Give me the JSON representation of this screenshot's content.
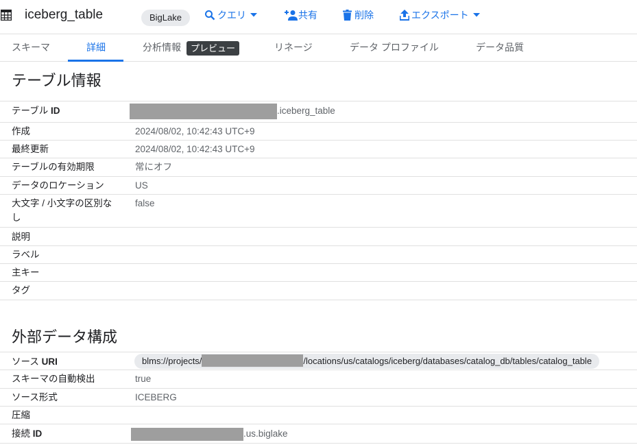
{
  "header": {
    "table_name": "iceberg_table",
    "table_type_chip": "BigLake",
    "actions": {
      "query": "クエリ",
      "share": "共有",
      "delete": "削除",
      "export": "エクスポート"
    }
  },
  "tabs": [
    {
      "label": "スキーマ"
    },
    {
      "label": "詳細",
      "active": true
    },
    {
      "label": "分析情報",
      "badge": "プレビュー"
    },
    {
      "label": "リネージ"
    },
    {
      "label": "データ プロファイル"
    },
    {
      "label": "データ品質"
    }
  ],
  "table_info": {
    "title": "テーブル情報",
    "rows": {
      "table_id": {
        "label_prefix": "テーブル ",
        "label_bold": "ID",
        "value_suffix": ".iceberg_table"
      },
      "created": {
        "label": "作成",
        "value": "2024/08/02, 10:42:43 UTC+9"
      },
      "last_modified": {
        "label": "最終更新",
        "value": "2024/08/02, 10:42:43 UTC+9"
      },
      "expiration": {
        "label": "テーブルの有効期限",
        "value": "常にオフ"
      },
      "location": {
        "label": "データのロケーション",
        "value": "US"
      },
      "case_insensitive": {
        "label": "大文字 / 小文字の区別なし",
        "value": "false"
      },
      "description": {
        "label": "説明",
        "value": ""
      },
      "labels": {
        "label": "ラベル",
        "value": ""
      },
      "primary_key": {
        "label": "主キー",
        "value": ""
      },
      "tags": {
        "label": "タグ",
        "value": ""
      }
    }
  },
  "external_config": {
    "title": "外部データ構成",
    "rows": {
      "source_uri": {
        "label_prefix": "ソース ",
        "label_bold": "URI",
        "value_prefix": "blms://projects/",
        "value_suffix": "/locations/us/catalogs/iceberg/databases/catalog_db/tables/catalog_table"
      },
      "autodetect": {
        "label": "スキーマの自動検出",
        "value": "true"
      },
      "source_format": {
        "label": "ソース形式",
        "value": "ICEBERG"
      },
      "compression": {
        "label": "圧縮",
        "value": ""
      },
      "connection_id": {
        "label_prefix": "接続 ",
        "label_bold": "ID",
        "value_suffix": ".us.biglake"
      }
    }
  },
  "colors": {
    "accent": "#1a73e8",
    "text": "#202124",
    "secondary_text": "#5f6368",
    "divider": "#e0e0e0",
    "chip_bg": "#e8eaed",
    "redaction": "#9e9e9e",
    "badge_bg": "#3c4043"
  },
  "icons": [
    "table-grid-icon",
    "search-icon",
    "dropdown-arrow-icon",
    "person-add-icon",
    "trash-icon",
    "upload-icon"
  ]
}
